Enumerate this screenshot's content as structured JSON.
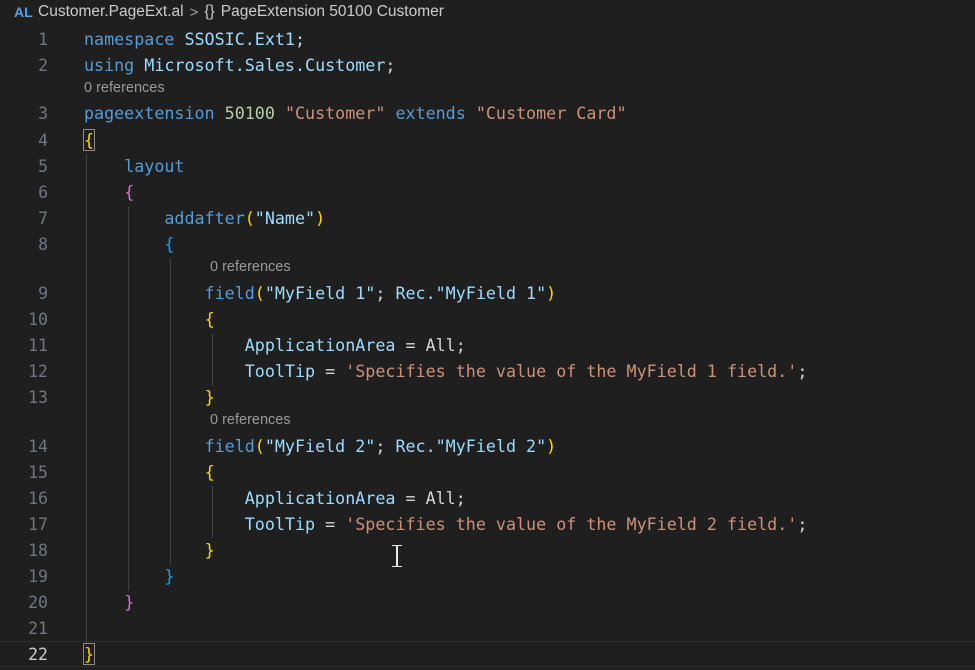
{
  "breadcrumb": {
    "language_badge": "AL",
    "file": "Customer.PageExt.al",
    "separator": ">",
    "symbol_icon": "{}",
    "symbol": "PageExtension 50100 Customer"
  },
  "codelens": {
    "line3": "0 references",
    "line9": "0 references",
    "line14": "0 references"
  },
  "colors": {
    "keyword": "#569cd6",
    "identifier": "#9cdcfe",
    "string": "#ce9178",
    "number": "#b5cea8",
    "bracket_level1": "#ffd700",
    "bracket_level2": "#da70d6",
    "bracket_level3": "#179fff"
  },
  "editor": {
    "active_line": 22,
    "lines": [
      {
        "n": "1",
        "tokens": [
          {
            "t": "namespace",
            "c": "kw"
          },
          {
            "t": " SSOSIC.Ext1",
            "c": "ident"
          },
          {
            "t": ";",
            "c": "plain"
          }
        ]
      },
      {
        "n": "2",
        "tokens": [
          {
            "t": "using",
            "c": "kw"
          },
          {
            "t": " Microsoft.Sales.Customer",
            "c": "ident"
          },
          {
            "t": ";",
            "c": "plain"
          }
        ]
      },
      {
        "n": "3",
        "tokens": [
          {
            "t": "pageextension",
            "c": "kw"
          },
          {
            "t": " ",
            "c": "plain"
          },
          {
            "t": "50100",
            "c": "num"
          },
          {
            "t": " ",
            "c": "plain"
          },
          {
            "t": "\"Customer\"",
            "c": "str"
          },
          {
            "t": " ",
            "c": "plain"
          },
          {
            "t": "extends",
            "c": "kw"
          },
          {
            "t": " ",
            "c": "plain"
          },
          {
            "t": "\"Customer Card\"",
            "c": "str"
          }
        ]
      },
      {
        "n": "4",
        "tokens": [
          {
            "t": "{",
            "c": "b1 box"
          }
        ]
      },
      {
        "n": "5",
        "tokens": [
          {
            "t": "    ",
            "c": "plain"
          },
          {
            "t": "layout",
            "c": "kw"
          }
        ]
      },
      {
        "n": "6",
        "tokens": [
          {
            "t": "    ",
            "c": "plain"
          },
          {
            "t": "{",
            "c": "b2"
          }
        ]
      },
      {
        "n": "7",
        "tokens": [
          {
            "t": "        ",
            "c": "plain"
          },
          {
            "t": "addafter",
            "c": "kw"
          },
          {
            "t": "(",
            "c": "b1"
          },
          {
            "t": "\"Name\"",
            "c": "ident"
          },
          {
            "t": ")",
            "c": "b1"
          }
        ]
      },
      {
        "n": "8",
        "tokens": [
          {
            "t": "        ",
            "c": "plain"
          },
          {
            "t": "{",
            "c": "b3"
          }
        ]
      },
      {
        "n": "9",
        "tokens": [
          {
            "t": "            ",
            "c": "plain"
          },
          {
            "t": "field",
            "c": "kw"
          },
          {
            "t": "(",
            "c": "b1"
          },
          {
            "t": "\"MyField 1\"",
            "c": "ident"
          },
          {
            "t": "; ",
            "c": "plain"
          },
          {
            "t": "Rec.",
            "c": "ident"
          },
          {
            "t": "\"MyField 1\"",
            "c": "ident"
          },
          {
            "t": ")",
            "c": "b1"
          }
        ]
      },
      {
        "n": "10",
        "tokens": [
          {
            "t": "            ",
            "c": "plain"
          },
          {
            "t": "{",
            "c": "b1"
          }
        ]
      },
      {
        "n": "11",
        "tokens": [
          {
            "t": "                ",
            "c": "plain"
          },
          {
            "t": "ApplicationArea",
            "c": "ident"
          },
          {
            "t": " = All;",
            "c": "plain"
          }
        ]
      },
      {
        "n": "12",
        "tokens": [
          {
            "t": "                ",
            "c": "plain"
          },
          {
            "t": "ToolTip",
            "c": "ident"
          },
          {
            "t": " = ",
            "c": "plain"
          },
          {
            "t": "'Specifies the value of the MyField 1 field.'",
            "c": "str"
          },
          {
            "t": ";",
            "c": "plain"
          }
        ]
      },
      {
        "n": "13",
        "tokens": [
          {
            "t": "            ",
            "c": "plain"
          },
          {
            "t": "}",
            "c": "b1"
          }
        ]
      },
      {
        "n": "14",
        "tokens": [
          {
            "t": "            ",
            "c": "plain"
          },
          {
            "t": "field",
            "c": "kw"
          },
          {
            "t": "(",
            "c": "b1"
          },
          {
            "t": "\"MyField 2\"",
            "c": "ident"
          },
          {
            "t": "; ",
            "c": "plain"
          },
          {
            "t": "Rec.",
            "c": "ident"
          },
          {
            "t": "\"MyField 2\"",
            "c": "ident"
          },
          {
            "t": ")",
            "c": "b1"
          }
        ]
      },
      {
        "n": "15",
        "tokens": [
          {
            "t": "            ",
            "c": "plain"
          },
          {
            "t": "{",
            "c": "b1"
          }
        ]
      },
      {
        "n": "16",
        "tokens": [
          {
            "t": "                ",
            "c": "plain"
          },
          {
            "t": "ApplicationArea",
            "c": "ident"
          },
          {
            "t": " = All;",
            "c": "plain"
          }
        ]
      },
      {
        "n": "17",
        "tokens": [
          {
            "t": "                ",
            "c": "plain"
          },
          {
            "t": "ToolTip",
            "c": "ident"
          },
          {
            "t": " = ",
            "c": "plain"
          },
          {
            "t": "'Specifies the value of the MyField 2 field.'",
            "c": "str"
          },
          {
            "t": ";",
            "c": "plain"
          }
        ]
      },
      {
        "n": "18",
        "tokens": [
          {
            "t": "            ",
            "c": "plain"
          },
          {
            "t": "}",
            "c": "b1"
          }
        ]
      },
      {
        "n": "19",
        "tokens": [
          {
            "t": "        ",
            "c": "plain"
          },
          {
            "t": "}",
            "c": "b3"
          }
        ]
      },
      {
        "n": "20",
        "tokens": [
          {
            "t": "    ",
            "c": "plain"
          },
          {
            "t": "}",
            "c": "b2"
          }
        ]
      },
      {
        "n": "21",
        "tokens": []
      },
      {
        "n": "22",
        "tokens": [
          {
            "t": "}",
            "c": "b1 box"
          }
        ]
      }
    ]
  }
}
